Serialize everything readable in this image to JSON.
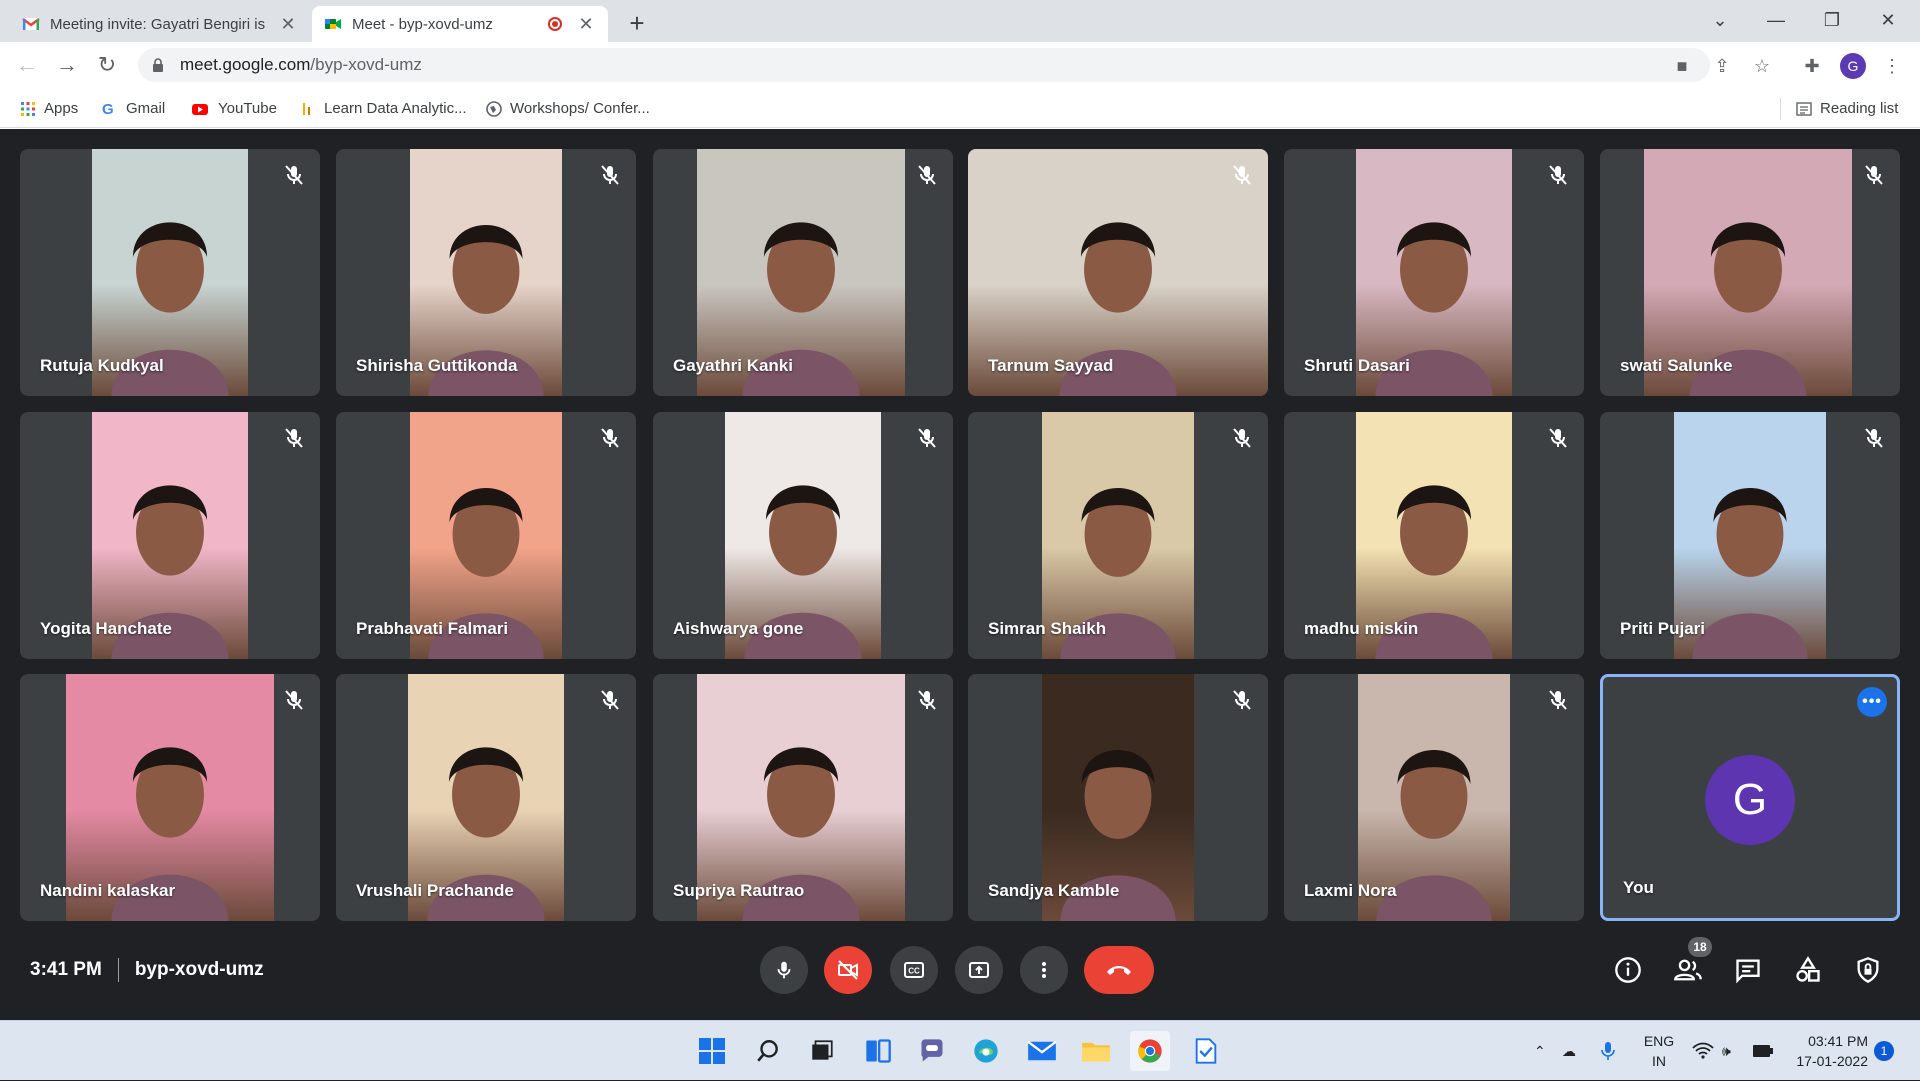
{
  "browser": {
    "tabs": [
      {
        "title": "Meeting invite: Gayatri Bengiri is",
        "active": false
      },
      {
        "title": "Meet - byp-xovd-umz",
        "active": true
      }
    ],
    "url_host": "meet.google.com",
    "url_path": "/byp-xovd-umz",
    "profile_initial": "G",
    "bookmarks": [
      "Apps",
      "Gmail",
      "YouTube",
      "Learn Data Analytic...",
      "Workshops/ Confer..."
    ],
    "reading_list": "Reading list"
  },
  "meet": {
    "colors": {
      "stage": "#202124",
      "tile": "#3c4043",
      "accent": "#8ab4f8",
      "danger": "#ea4335",
      "avatar": "#5e35b1"
    },
    "participants": [
      {
        "name": "Rutuja Kudkyal",
        "muted": true,
        "video_bg": "#c7d4d2"
      },
      {
        "name": "Shirisha Guttikonda",
        "muted": true,
        "video_bg": "#e6d3c9"
      },
      {
        "name": "Gayathri Kanki",
        "muted": true,
        "video_bg": "#c9c6c0"
      },
      {
        "name": "Tarnum Sayyad",
        "muted": true,
        "video_bg": "#d9d2c8"
      },
      {
        "name": "Shruti Dasari",
        "muted": true,
        "video_bg": "#d8b8c2"
      },
      {
        "name": "swati Salunke",
        "muted": true,
        "video_bg": "#d3a9b6"
      },
      {
        "name": "Yogita Hanchate",
        "muted": true,
        "video_bg": "#f1b6c8"
      },
      {
        "name": "Prabhavati Falmari",
        "muted": true,
        "video_bg": "#f2a48a"
      },
      {
        "name": "Aishwarya gone",
        "muted": true,
        "video_bg": "#eee8e6"
      },
      {
        "name": "Simran Shaikh",
        "muted": true,
        "video_bg": "#d9c9a8"
      },
      {
        "name": "madhu miskin",
        "muted": true,
        "video_bg": "#f3e2b3"
      },
      {
        "name": "Priti Pujari",
        "muted": true,
        "video_bg": "#b9d4ec"
      },
      {
        "name": "Nandini kalaskar",
        "muted": true,
        "video_bg": "#e58aa5"
      },
      {
        "name": "Vrushali Prachande",
        "muted": true,
        "video_bg": "#e9d3b5"
      },
      {
        "name": "Supriya Rautrao",
        "muted": true,
        "video_bg": "#e7cfd4"
      },
      {
        "name": "Sandjya Kamble",
        "muted": true,
        "video_bg": "#3a2a20"
      },
      {
        "name": "Laxmi Nora",
        "muted": true,
        "video_bg": "#c9b7ad"
      }
    ],
    "self": {
      "name": "You",
      "initial": "G"
    },
    "time": "3:41 PM",
    "meeting_code": "byp-xovd-umz",
    "participant_count": "18"
  },
  "taskbar": {
    "lang_top": "ENG",
    "lang_bottom": "IN",
    "time": "03:41 PM",
    "date": "17-01-2022",
    "notifications": "1"
  }
}
